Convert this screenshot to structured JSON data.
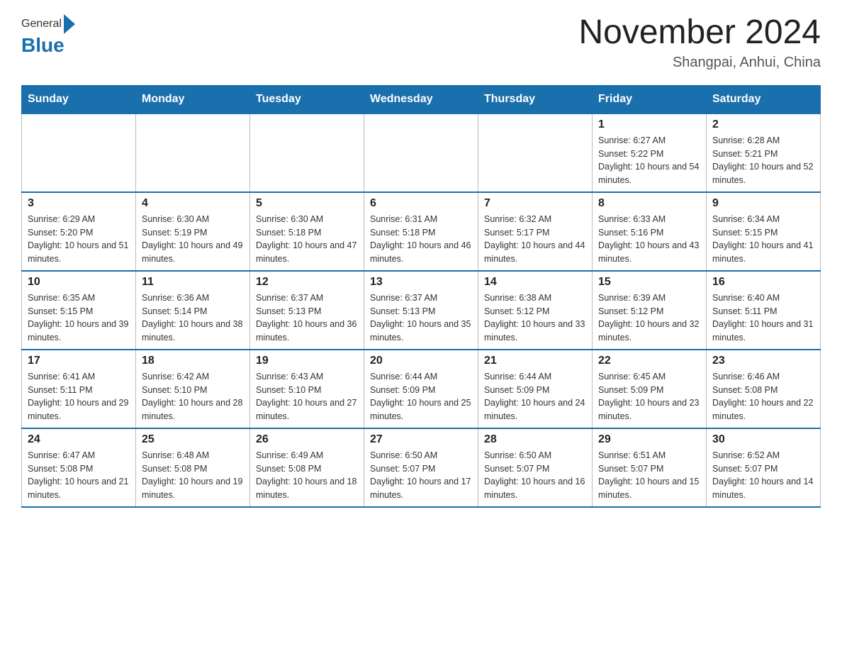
{
  "header": {
    "logo": {
      "general": "General",
      "blue": "Blue",
      "arrow_color": "#1a6fad"
    },
    "title": "November 2024",
    "location": "Shangpai, Anhui, China"
  },
  "weekdays": [
    "Sunday",
    "Monday",
    "Tuesday",
    "Wednesday",
    "Thursday",
    "Friday",
    "Saturday"
  ],
  "weeks": [
    [
      {
        "day": "",
        "info": ""
      },
      {
        "day": "",
        "info": ""
      },
      {
        "day": "",
        "info": ""
      },
      {
        "day": "",
        "info": ""
      },
      {
        "day": "",
        "info": ""
      },
      {
        "day": "1",
        "info": "Sunrise: 6:27 AM\nSunset: 5:22 PM\nDaylight: 10 hours and 54 minutes."
      },
      {
        "day": "2",
        "info": "Sunrise: 6:28 AM\nSunset: 5:21 PM\nDaylight: 10 hours and 52 minutes."
      }
    ],
    [
      {
        "day": "3",
        "info": "Sunrise: 6:29 AM\nSunset: 5:20 PM\nDaylight: 10 hours and 51 minutes."
      },
      {
        "day": "4",
        "info": "Sunrise: 6:30 AM\nSunset: 5:19 PM\nDaylight: 10 hours and 49 minutes."
      },
      {
        "day": "5",
        "info": "Sunrise: 6:30 AM\nSunset: 5:18 PM\nDaylight: 10 hours and 47 minutes."
      },
      {
        "day": "6",
        "info": "Sunrise: 6:31 AM\nSunset: 5:18 PM\nDaylight: 10 hours and 46 minutes."
      },
      {
        "day": "7",
        "info": "Sunrise: 6:32 AM\nSunset: 5:17 PM\nDaylight: 10 hours and 44 minutes."
      },
      {
        "day": "8",
        "info": "Sunrise: 6:33 AM\nSunset: 5:16 PM\nDaylight: 10 hours and 43 minutes."
      },
      {
        "day": "9",
        "info": "Sunrise: 6:34 AM\nSunset: 5:15 PM\nDaylight: 10 hours and 41 minutes."
      }
    ],
    [
      {
        "day": "10",
        "info": "Sunrise: 6:35 AM\nSunset: 5:15 PM\nDaylight: 10 hours and 39 minutes."
      },
      {
        "day": "11",
        "info": "Sunrise: 6:36 AM\nSunset: 5:14 PM\nDaylight: 10 hours and 38 minutes."
      },
      {
        "day": "12",
        "info": "Sunrise: 6:37 AM\nSunset: 5:13 PM\nDaylight: 10 hours and 36 minutes."
      },
      {
        "day": "13",
        "info": "Sunrise: 6:37 AM\nSunset: 5:13 PM\nDaylight: 10 hours and 35 minutes."
      },
      {
        "day": "14",
        "info": "Sunrise: 6:38 AM\nSunset: 5:12 PM\nDaylight: 10 hours and 33 minutes."
      },
      {
        "day": "15",
        "info": "Sunrise: 6:39 AM\nSunset: 5:12 PM\nDaylight: 10 hours and 32 minutes."
      },
      {
        "day": "16",
        "info": "Sunrise: 6:40 AM\nSunset: 5:11 PM\nDaylight: 10 hours and 31 minutes."
      }
    ],
    [
      {
        "day": "17",
        "info": "Sunrise: 6:41 AM\nSunset: 5:11 PM\nDaylight: 10 hours and 29 minutes."
      },
      {
        "day": "18",
        "info": "Sunrise: 6:42 AM\nSunset: 5:10 PM\nDaylight: 10 hours and 28 minutes."
      },
      {
        "day": "19",
        "info": "Sunrise: 6:43 AM\nSunset: 5:10 PM\nDaylight: 10 hours and 27 minutes."
      },
      {
        "day": "20",
        "info": "Sunrise: 6:44 AM\nSunset: 5:09 PM\nDaylight: 10 hours and 25 minutes."
      },
      {
        "day": "21",
        "info": "Sunrise: 6:44 AM\nSunset: 5:09 PM\nDaylight: 10 hours and 24 minutes."
      },
      {
        "day": "22",
        "info": "Sunrise: 6:45 AM\nSunset: 5:09 PM\nDaylight: 10 hours and 23 minutes."
      },
      {
        "day": "23",
        "info": "Sunrise: 6:46 AM\nSunset: 5:08 PM\nDaylight: 10 hours and 22 minutes."
      }
    ],
    [
      {
        "day": "24",
        "info": "Sunrise: 6:47 AM\nSunset: 5:08 PM\nDaylight: 10 hours and 21 minutes."
      },
      {
        "day": "25",
        "info": "Sunrise: 6:48 AM\nSunset: 5:08 PM\nDaylight: 10 hours and 19 minutes."
      },
      {
        "day": "26",
        "info": "Sunrise: 6:49 AM\nSunset: 5:08 PM\nDaylight: 10 hours and 18 minutes."
      },
      {
        "day": "27",
        "info": "Sunrise: 6:50 AM\nSunset: 5:07 PM\nDaylight: 10 hours and 17 minutes."
      },
      {
        "day": "28",
        "info": "Sunrise: 6:50 AM\nSunset: 5:07 PM\nDaylight: 10 hours and 16 minutes."
      },
      {
        "day": "29",
        "info": "Sunrise: 6:51 AM\nSunset: 5:07 PM\nDaylight: 10 hours and 15 minutes."
      },
      {
        "day": "30",
        "info": "Sunrise: 6:52 AM\nSunset: 5:07 PM\nDaylight: 10 hours and 14 minutes."
      }
    ]
  ]
}
